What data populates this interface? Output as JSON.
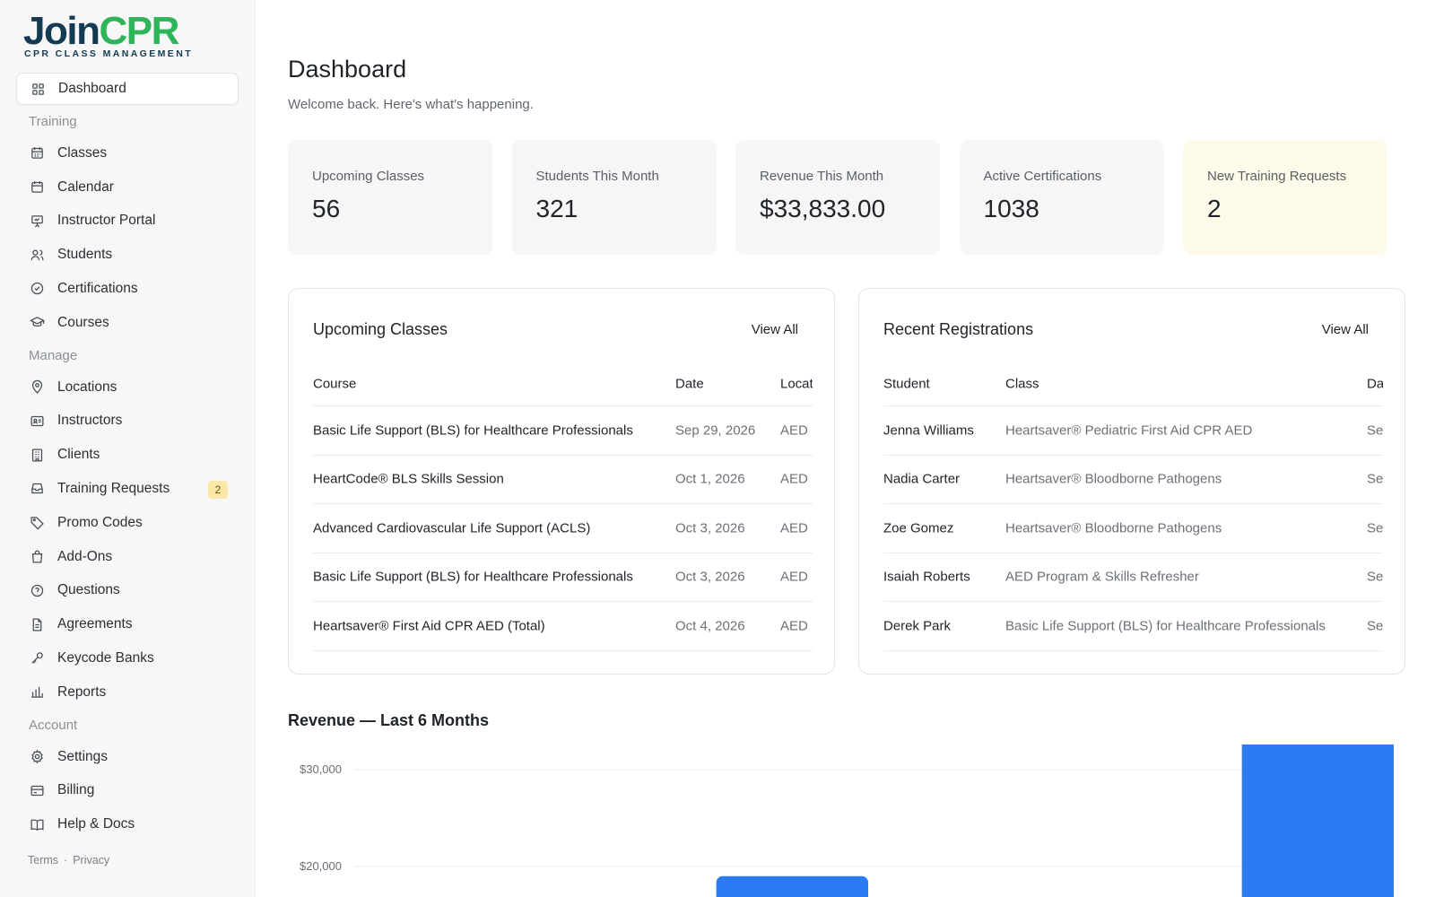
{
  "brand": {
    "name_part1": "Join",
    "name_part2": "CPR",
    "tagline": "CPR CLASS MANAGEMENT",
    "primary_color": "#123a52",
    "accent_color": "#2fb45a"
  },
  "sidebar": {
    "top": [
      {
        "label": "Dashboard",
        "icon": "grid-icon",
        "active": true
      }
    ],
    "sections": [
      {
        "title": "Training",
        "items": [
          {
            "label": "Classes",
            "icon": "calendar-grid-icon"
          },
          {
            "label": "Calendar",
            "icon": "calendar-icon"
          },
          {
            "label": "Instructor Portal",
            "icon": "presentation-icon"
          },
          {
            "label": "Students",
            "icon": "users-icon"
          },
          {
            "label": "Certifications",
            "icon": "check-circle-icon"
          },
          {
            "label": "Courses",
            "icon": "graduation-cap-icon"
          }
        ]
      },
      {
        "title": "Manage",
        "items": [
          {
            "label": "Locations",
            "icon": "map-pin-icon"
          },
          {
            "label": "Instructors",
            "icon": "id-card-icon"
          },
          {
            "label": "Clients",
            "icon": "building-icon"
          },
          {
            "label": "Training Requests",
            "icon": "inbox-icon",
            "badge": "2"
          },
          {
            "label": "Promo Codes",
            "icon": "tag-icon"
          },
          {
            "label": "Add-Ons",
            "icon": "shopping-bag-icon"
          },
          {
            "label": "Questions",
            "icon": "help-circle-icon"
          },
          {
            "label": "Agreements",
            "icon": "document-icon"
          },
          {
            "label": "Keycode Banks",
            "icon": "key-icon"
          },
          {
            "label": "Reports",
            "icon": "bar-chart-icon"
          }
        ]
      },
      {
        "title": "Account",
        "items": [
          {
            "label": "Settings",
            "icon": "gear-icon"
          },
          {
            "label": "Billing",
            "icon": "credit-card-icon"
          },
          {
            "label": "Help & Docs",
            "icon": "book-icon"
          }
        ]
      }
    ],
    "footer": {
      "terms": "Terms",
      "separator": "·",
      "privacy": "Privacy"
    }
  },
  "header": {
    "title": "Dashboard",
    "subtitle": "Welcome back. Here's what's happening."
  },
  "stats": [
    {
      "label": "Upcoming Classes",
      "value": "56"
    },
    {
      "label": "Students This Month",
      "value": "321"
    },
    {
      "label": "Revenue This Month",
      "value": "$33,833.00"
    },
    {
      "label": "Active Certifications",
      "value": "1038"
    },
    {
      "label": "New Training Requests",
      "value": "2",
      "highlight": true
    }
  ],
  "upcoming_classes": {
    "title": "Upcoming Classes",
    "view_all": "View All",
    "columns": [
      "Course",
      "Date",
      "Location"
    ],
    "rows": [
      [
        "Basic Life Support (BLS) for Healthcare Professionals",
        "Sep 29, 2026",
        "AED"
      ],
      [
        "HeartCode® BLS Skills Session",
        "Oct 1, 2026",
        "AED"
      ],
      [
        "Advanced Cardiovascular Life Support (ACLS)",
        "Oct 3, 2026",
        "AED"
      ],
      [
        "Basic Life Support (BLS) for Healthcare Professionals",
        "Oct 3, 2026",
        "AED"
      ],
      [
        "Heartsaver® First Aid CPR AED (Total)",
        "Oct 4, 2026",
        "AED"
      ]
    ]
  },
  "recent_registrations": {
    "title": "Recent Registrations",
    "view_all": "View All",
    "columns": [
      "Student",
      "Class",
      "Date"
    ],
    "rows": [
      [
        "Jenna Williams",
        "Heartsaver® Pediatric First Aid CPR AED",
        "Sep"
      ],
      [
        "Nadia Carter",
        "Heartsaver® Bloodborne Pathogens",
        "Sep"
      ],
      [
        "Zoe Gomez",
        "Heartsaver® Bloodborne Pathogens",
        "Sep"
      ],
      [
        "Isaiah Roberts",
        "AED Program & Skills Refresher",
        "Sep"
      ],
      [
        "Derek Park",
        "Basic Life Support (BLS) for Healthcare Professionals",
        "Sep"
      ]
    ]
  },
  "revenue": {
    "title": "Revenue — Last 6 Months",
    "chart_data": {
      "type": "bar",
      "title": "Revenue — Last 6 Months",
      "bar_color": "#2b7bf3",
      "y_ticks": [
        20000,
        30000
      ],
      "y_tick_labels": [
        "$20,000",
        "$30,000"
      ],
      "visible_bars": [
        {
          "index": 2,
          "value": 19000
        },
        {
          "index": 5,
          "value": 33833
        }
      ],
      "grid": true
    }
  }
}
